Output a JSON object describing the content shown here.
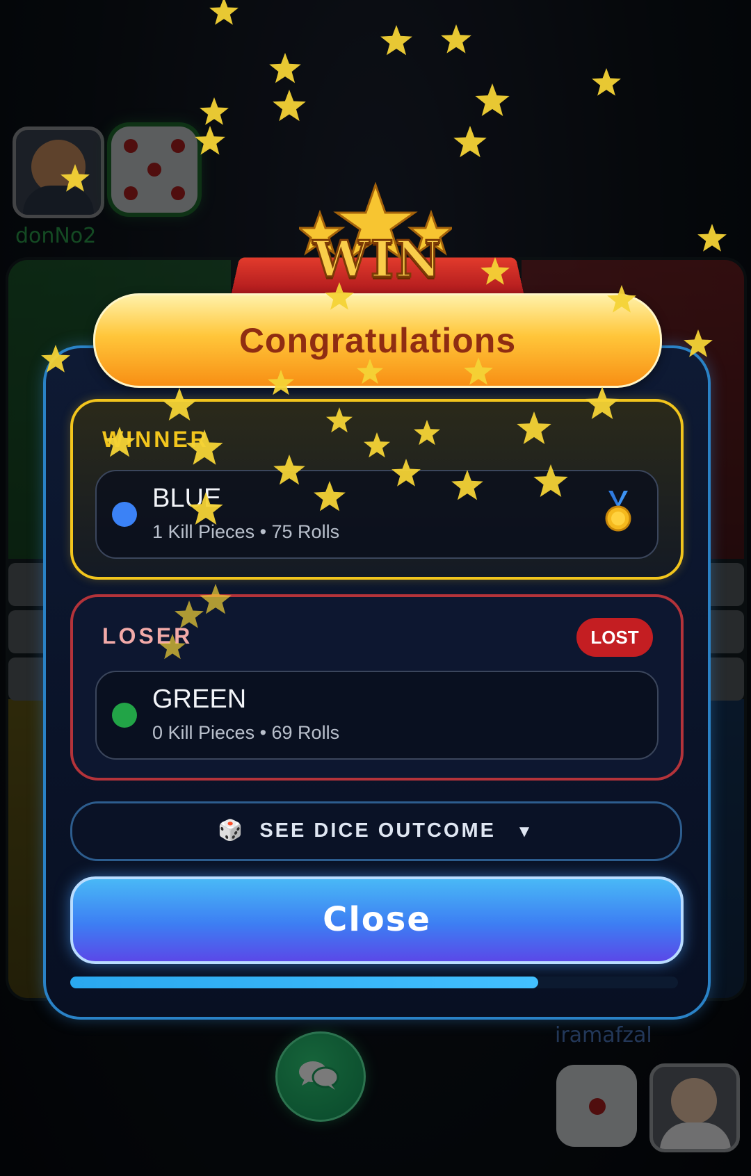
{
  "players": {
    "top_left": {
      "name": "donNo2",
      "dice_value": 5,
      "name_color": "#2a9b49"
    },
    "bottom_right": {
      "name": "iramafzal",
      "dice_value": 1,
      "name_color": "#4a73b8"
    }
  },
  "modal": {
    "banner_text": "WIN",
    "title": "Congratulations",
    "winner": {
      "label": "WINNER",
      "color_name": "BLUE",
      "dot_color": "#3b82f6",
      "stats": "1 Kill Pieces • 75 Rolls",
      "medal_icon": "gold-medal-icon"
    },
    "loser": {
      "label": "LOSER",
      "badge": "LOST",
      "color_name": "GREEN",
      "dot_color": "#22a447",
      "stats": "0 Kill Pieces • 69 Rolls"
    },
    "dice_outcome": {
      "icon": "🎲",
      "label": "SEE DICE OUTCOME",
      "arrow": "▼"
    },
    "close_label": "Close",
    "auto_close_progress": 0.77
  },
  "chat_button": {
    "icon": "chat-bubbles-icon"
  },
  "colors": {
    "accent_gold": "#f2c51d",
    "loser_red": "#b4333a",
    "modal_border": "#2a82c6",
    "close_button": "#3d7ef3"
  }
}
